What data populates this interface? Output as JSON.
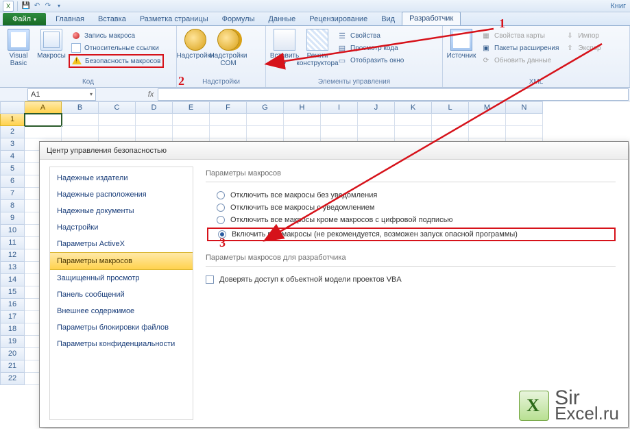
{
  "titlebar": {
    "book": "Книг"
  },
  "tabs": {
    "file": "Файл",
    "items": [
      "Главная",
      "Вставка",
      "Разметка страницы",
      "Формулы",
      "Данные",
      "Рецензирование",
      "Вид",
      "Разработчик"
    ],
    "active": "Разработчик"
  },
  "ribbon": {
    "vb": "Visual\nBasic",
    "macros": "Макросы",
    "record": "Запись макроса",
    "relative": "Относительные ссылки",
    "security": "Безопасность макросов",
    "group_code": "Код",
    "addins": "Надстройки",
    "addins_com": "Надстройки\nCOM",
    "group_addins": "Надстройки",
    "insert": "Вставить",
    "design": "Режим\nконструктора",
    "props": "Свойства",
    "viewcode": "Просмотр кода",
    "showdlg": "Отобразить окно",
    "group_controls": "Элементы управления",
    "source": "Источник",
    "map_props": "Свойства карты",
    "expansion": "Пакеты расширения",
    "refresh": "Обновить данные",
    "import": "Импор",
    "export": "Экспор",
    "group_xml": "XML"
  },
  "namebox": "A1",
  "columns": [
    "A",
    "B",
    "C",
    "D",
    "E",
    "F",
    "G",
    "H",
    "I",
    "J",
    "K",
    "L",
    "M",
    "N"
  ],
  "rows": [
    "1",
    "2",
    "3",
    "4",
    "5",
    "6",
    "7",
    "8",
    "9",
    "10",
    "11",
    "12",
    "13",
    "14",
    "15",
    "16",
    "17",
    "18",
    "19",
    "20",
    "21",
    "22"
  ],
  "dialog": {
    "title": "Центр управления безопасностью",
    "nav": [
      "Надежные издатели",
      "Надежные расположения",
      "Надежные документы",
      "Надстройки",
      "Параметры ActiveX",
      "Параметры макросов",
      "Защищенный просмотр",
      "Панель сообщений",
      "Внешнее содержимое",
      "Параметры блокировки файлов",
      "Параметры конфиденциальности"
    ],
    "nav_active": 5,
    "section1": "Параметры макросов",
    "opts": [
      "Отключить все макросы без уведомления",
      "Отключить все макросы с уведомлением",
      "Отключить все макросы кроме макросов с цифровой подписью",
      "Включить все макросы (не рекомендуется, возможен запуск опасной программы)"
    ],
    "opt_selected": 3,
    "section2": "Параметры макросов для разработчика",
    "trust_vba": "Доверять доступ к объектной модели проектов VBA"
  },
  "annot": {
    "n1": "1",
    "n2": "2",
    "n3": "3"
  },
  "watermark": {
    "line1": "Sir",
    "line2": "Excel.ru"
  }
}
